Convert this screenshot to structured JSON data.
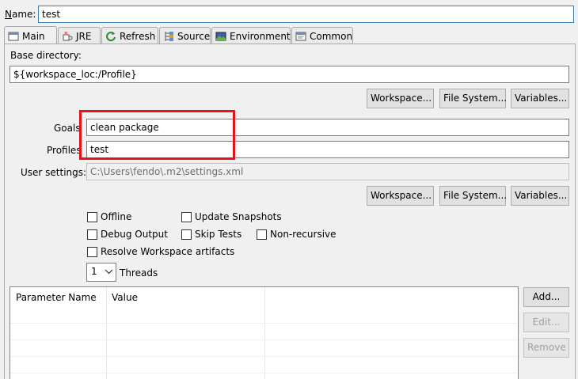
{
  "name": {
    "label": "Name:",
    "value": "test"
  },
  "tabs": [
    {
      "label": "Main",
      "icon": "main-tab-icon"
    },
    {
      "label": "JRE",
      "icon": "jre-icon"
    },
    {
      "label": "Refresh",
      "icon": "refresh-icon"
    },
    {
      "label": "Source",
      "icon": "source-icon"
    },
    {
      "label": "Environment",
      "icon": "environment-icon"
    },
    {
      "label": "Common",
      "icon": "common-icon"
    }
  ],
  "base_directory": {
    "label": "Base directory:",
    "value": "${workspace_loc:/Profile}",
    "buttons": {
      "workspace": "Workspace...",
      "filesystem": "File System...",
      "variables": "Variables..."
    }
  },
  "goals": {
    "label": "Goals",
    "value": "clean package"
  },
  "profiles": {
    "label": "Profiles",
    "value": "test"
  },
  "user_settings": {
    "label": "User settings:",
    "value": "C:\\Users\\fendo\\.m2\\settings.xml",
    "buttons": {
      "workspace": "Workspace...",
      "filesystem": "File System...",
      "variables": "Variables..."
    }
  },
  "options": {
    "offline": "Offline",
    "update_snapshots": "Update Snapshots",
    "debug_output": "Debug Output",
    "skip_tests": "Skip Tests",
    "non_recursive": "Non-recursive",
    "resolve_workspace": "Resolve Workspace artifacts"
  },
  "threads": {
    "value": "1",
    "label": "Threads"
  },
  "parameters": {
    "columns": [
      "Parameter Name",
      "Value"
    ],
    "rows": []
  },
  "param_buttons": {
    "add": "Add...",
    "edit": "Edit...",
    "remove": "Remove"
  },
  "colors": {
    "highlight": "#e5141a",
    "focus_border": "#3c7fb1"
  }
}
